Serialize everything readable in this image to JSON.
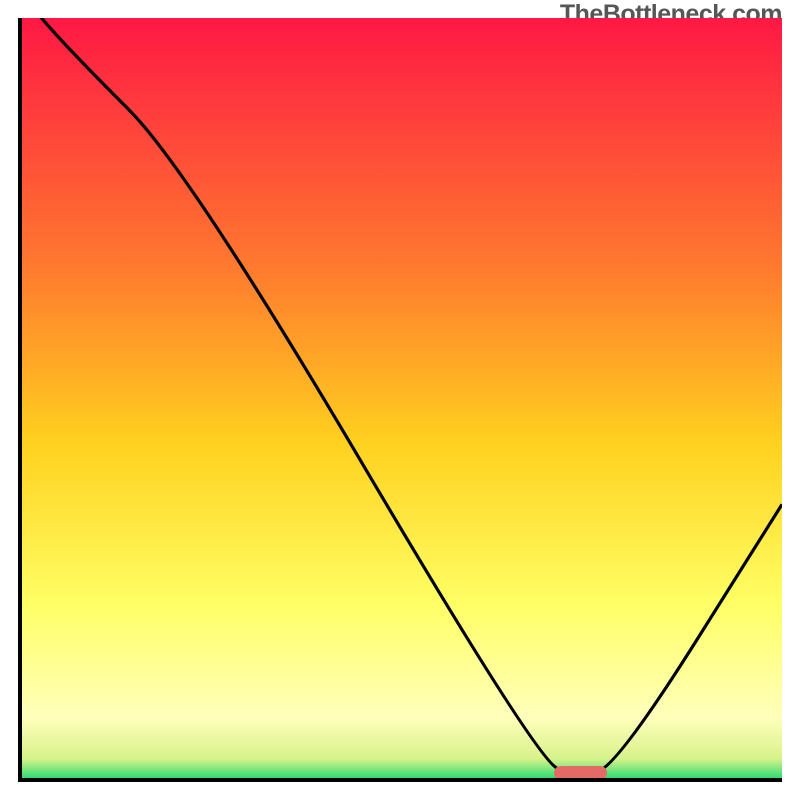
{
  "attribution": "TheBottleneck.com",
  "colors": {
    "top": "#ff1845",
    "upper_mid": "#ff7a2e",
    "mid": "#ffd11f",
    "lower_mid": "#ffff64",
    "near_bottom": "#ffffbb",
    "bottom": "#2fdd74",
    "curve": "#000000",
    "marker": "#e46a66"
  },
  "chart_data": {
    "type": "line",
    "title": "",
    "xlabel": "",
    "ylabel": "",
    "xlim": [
      0,
      100
    ],
    "ylim": [
      0,
      100
    ],
    "x": [
      0,
      6,
      22,
      68,
      73,
      78,
      100
    ],
    "values": [
      103,
      96,
      80,
      2,
      0.5,
      1,
      36
    ],
    "marker": {
      "x_start": 70,
      "x_end": 77,
      "y": 0.7
    },
    "gradient_stops": [
      {
        "pct": 0,
        "color": "#ff1845"
      },
      {
        "pct": 33,
        "color": "#ff7a2e"
      },
      {
        "pct": 56,
        "color": "#ffd11f"
      },
      {
        "pct": 77,
        "color": "#ffff64"
      },
      {
        "pct": 92,
        "color": "#ffffbb"
      },
      {
        "pct": 97.5,
        "color": "#d7f28a"
      },
      {
        "pct": 100,
        "color": "#2fdd74"
      }
    ]
  }
}
